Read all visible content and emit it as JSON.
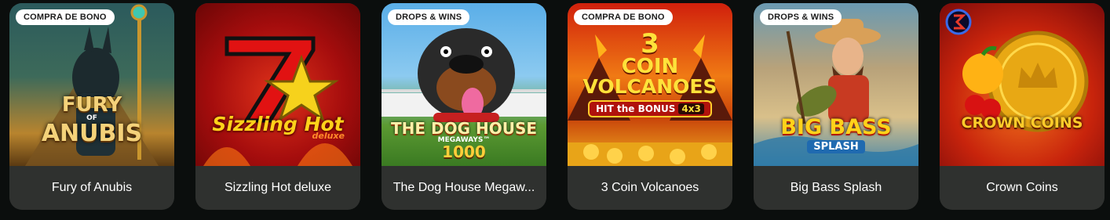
{
  "games": [
    {
      "title": "Fury of Anubis",
      "badge": "COMPRA DE BONO",
      "art_logo": [
        "FURY",
        "OF",
        "ANUBIS"
      ],
      "icon": "anubis-art-icon",
      "colors": {
        "bg1": "#1f4a4a",
        "bg2": "#b07a2a",
        "accent": "#e8b84a"
      }
    },
    {
      "title": "Sizzling Hot deluxe",
      "badge": "",
      "art_logo": [
        "Sizzling Hot",
        "deluxe"
      ],
      "icon": "seven-star-art-icon",
      "colors": {
        "bg1": "#8a0a0a",
        "bg2": "#d12a10",
        "accent": "#ffd21a"
      }
    },
    {
      "title": "The Dog House Megaw...",
      "badge": "DROPS & WINS",
      "art_logo": [
        "THE DOG HOUSE",
        "MEGAWAYS™",
        "1000"
      ],
      "icon": "dog-art-icon",
      "colors": {
        "bg1": "#5aa8e6",
        "bg2": "#4d8f2c",
        "accent": "#ffcf3a"
      }
    },
    {
      "title": "3 Coin Volcanoes",
      "badge": "COMPRA DE BONO",
      "art_logo": [
        "3",
        "COIN",
        "VOLCANOES",
        "HIT the BONUS",
        "4x3"
      ],
      "icon": "volcano-art-icon",
      "colors": {
        "bg1": "#c21a0c",
        "bg2": "#f29a1a",
        "accent": "#ffe23a"
      }
    },
    {
      "title": "Big Bass Splash",
      "badge": "DROPS & WINS",
      "art_logo": [
        "BIG BASS",
        "SPLASH"
      ],
      "icon": "fisherman-art-icon",
      "colors": {
        "bg1": "#5b8fa8",
        "bg2": "#c9a26a",
        "accent": "#ff3a1a"
      }
    },
    {
      "title": "Crown Coins",
      "badge": "",
      "art_logo": [
        "CROWN COINS"
      ],
      "icon": "crown-coin-art-icon",
      "colors": {
        "bg1": "#9a0c0c",
        "bg2": "#e5661a",
        "accent": "#ffcc2a"
      }
    }
  ]
}
